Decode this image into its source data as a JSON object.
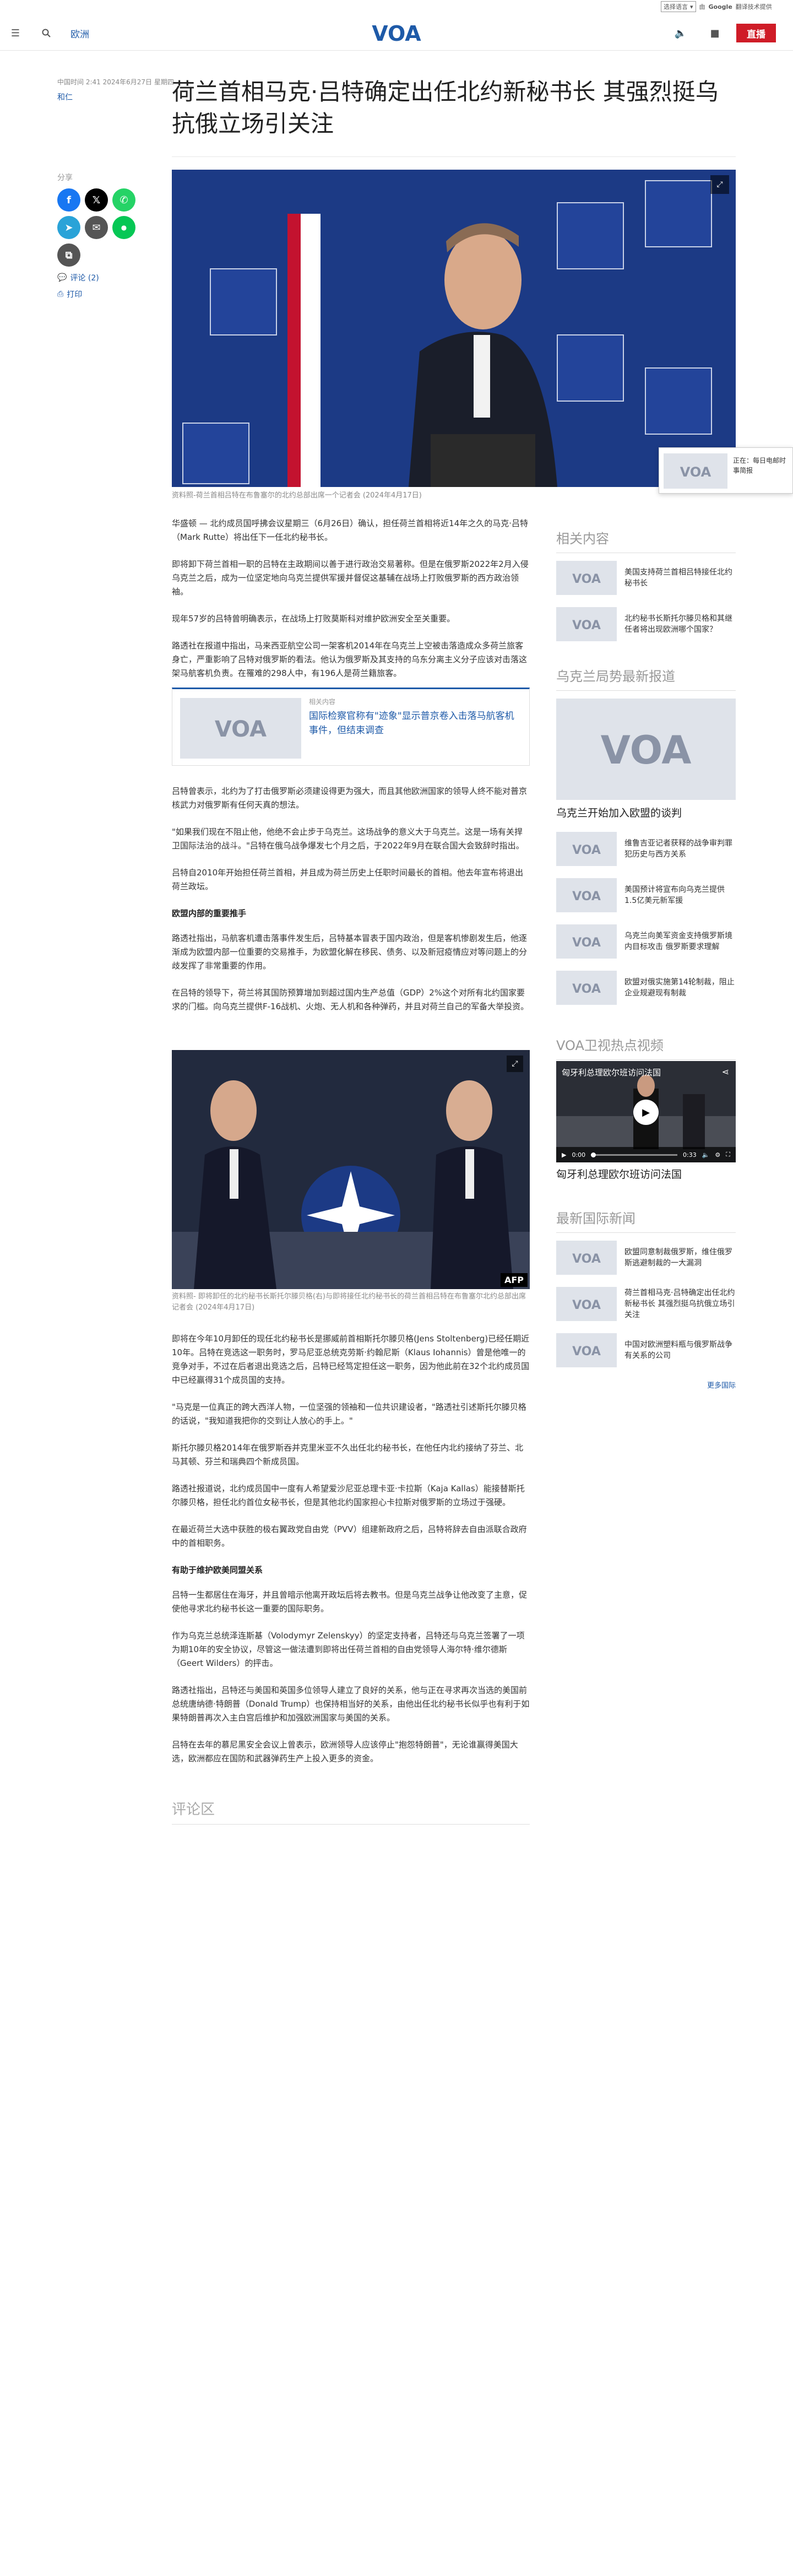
{
  "translate": {
    "select_label": "选择语言",
    "powered_prefix": "由",
    "powered_brand": "Google",
    "powered_suffix": "翻译技术提供"
  },
  "header": {
    "region": "欧洲",
    "logo_text": "VOA",
    "live_label": "直播"
  },
  "article": {
    "date": "中国时间 2:41 2024年6月27日 星期四",
    "author": "和仁",
    "title": "荷兰首相马克·吕特确定出任北约新秘书长 其强烈挺乌抗俄立场引关注",
    "share_label": "分享",
    "comments_link": "评论 (2)",
    "print_link": "打印",
    "hero_caption": "资料照-荷兰首相吕特在布鲁塞尔的北约总部出席一个记者会 (2024年4月17日)",
    "paragraphs_1": [
      "华盛顿 — 北约成员国呼拂会议星期三（6月26日）确认，担任荷兰首相将近14年之久的马克·吕特（Mark Rutte）将出任下一任北约秘书长。",
      "即将卸下荷兰首相一职的吕特在主政期间以善于进行政治交易著称。但是在俄罗斯2022年2月入侵乌克兰之后，成为一位坚定地向乌克兰提供军援并督促这基辅在战场上打败俄罗斯的西方政治领袖。",
      "现年57岁的吕特曾明确表示，在战场上打败莫斯科对维护欧洲安全至关重要。",
      "路透社在报道中指出，马来西亚航空公司一架客机2014年在乌克兰上空被击落造成众多荷兰旅客身亡，严重影响了吕特对俄罗斯的看法。他认为俄罗斯及其支持的乌东分离主义分子应该对击落这架马航客机负责。在罹难的298人中，有196人是荷兰籍旅客。"
    ],
    "related_card": {
      "kicker": "相关内容",
      "headline": "国际检察官称有\"迹象\"显示普京卷入击落马航客机事件，但结束调查"
    },
    "paragraphs_2": [
      "吕特曾表示，北约为了打击俄罗斯必须建设得更为强大，而且其他欧洲国家的领导人终不能对普京核武力对俄罗斯有任何天真的想法。",
      "\"如果我们现在不阻止他，他绝不会止步于乌克兰。这场战争的意义大于乌克兰。这是一场有关捍卫国际法治的战斗。\"吕特在俄乌战争爆发七个月之后，于2022年9月在联合国大会致辞时指出。",
      "吕特自2010年开始担任荷兰首相，并且成为荷兰历史上任职时间最长的首相。他去年宣布将退出荷兰政坛。"
    ],
    "h_1": "欧盟内部的重要推手",
    "paragraphs_3": [
      "路透社指出，马航客机遭击落事件发生后，吕特基本冒表于国内政治，但是客机惨剧发生后，他逐渐成为欧盟内部一位重要的交易推手，为欧盟化解在移民、债务、以及新冠疫情应对等问题上的分歧发挥了非常重要的作用。",
      "在吕特的领导下，荷兰将其国防预算增加到超过国内生产总值（GDP）2%这个对所有北约国家要求的门槛。向乌克兰提供F-16战机、火炮、无人机和各种弹药，并且对荷兰自己的军备大举投资。"
    ],
    "photo2_caption": "资料照- 即将卸任的北约秘书长斯托尔滕贝格(右)与即将接任北约秘书长的荷兰首相吕特在布鲁塞尔北约总部出席记者会 (2024年4月17日)",
    "photo2_badge": "AFP",
    "paragraphs_4": [
      "即将在今年10月卸任的现任北约秘书长是挪威前首相斯托尔滕贝格(Jens Stoltenberg)已经任期近10年。吕特在竞选这一职务时，罗马尼亚总统克劳斯·约翰尼斯（Klaus Iohannis）曾是他唯一的竞争对手，不过在后者退出竞选之后，吕特已经笃定担任这一职务，因为他此前在32个北约成员国中已经赢得31个成员国的支持。",
      "\"马克是一位真正的跨大西洋人物，一位坚强的领袖和一位共识建设者，\"路透社引述斯托尔滕贝格的话说，\"我知道我把你的交到让人放心的手上。\"",
      "斯托尔滕贝格2014年在俄罗斯吞并克里米亚不久出任北约秘书长，在他任内北约接纳了芬兰、北马其顿、芬兰和瑞典四个新成员国。",
      "路透社报道说，北约成员国中一度有人希望爱沙尼亚总理卡亚·卡拉斯（Kaja Kallas）能接替斯托尔滕贝格，担任北约首位女秘书长，但是其他北约国家担心卡拉斯对俄罗斯的立场过于强硬。",
      "在最近荷兰大选中获胜的极右翼政党自由党（PVV）组建新政府之后，吕特将辞去自由派联合政府中的首相职务。"
    ],
    "h_2": "有助于维护欧美同盟关系",
    "paragraphs_5": [
      "吕特一生都居住在海牙，并且曾暗示他离开政坛后将去教书。但是乌克兰战争让他改变了主意，促使他寻求北约秘书长这一重要的国际职务。",
      "作为乌克兰总统泽连斯基（Volodymyr Zelenskyy）的坚定支持者，吕特还与乌克兰签署了一项为期10年的安全协议，尽管这一做法遭到即将出任荷兰首相的自由党领导人海尔特·维尔德斯（Geert Wilders）的抨击。",
      "路透社指出，吕特还与美国和英国多位领导人建立了良好的关系，他与正在寻求再次当选的美国前总统唐纳德·特朗普（Donald Trump）也保持相当好的关系，由他出任北约秘书长似乎也有利于如果特朗普再次入主白宫后维护和加强欧洲国家与美国的关系。",
      "吕特在去年的慕尼黑安全会议上曾表示，欧洲领导人应该停止\"抱怨特朗普\"，无论谁赢得美国大选，欧洲都应在国防和武器弹药生产上投入更多的资金。"
    ],
    "comments_heading": "评论区"
  },
  "sidebar": {
    "related_heading": "相关内容",
    "related": [
      "美国支持荷兰首相吕特接任北约秘书长",
      "北约秘书长斯托尔滕贝格和其继任者将出现欧洲哪个国家？"
    ],
    "ukraine_heading": "乌克兰局势最新报道",
    "ukraine_feature": "乌克兰开始加入欧盟的谈判",
    "ukraine": [
      "维鲁吉亚记者获释的战争审判罪犯历史与西方关系",
      "美国预计将宣布向乌克兰提供1.5亿美元新军援",
      "乌克兰向美军资金支持俄罗斯境内目标攻击 俄罗斯要求理解",
      "欧盟对俄实施第14轮制裁，阻止企业规避现有制裁"
    ],
    "video_heading": "VOA卫视热点视频",
    "video_title": "匈牙利总理欧尔班访问法国",
    "video_time_current": "0:00",
    "video_time_total": "0:33",
    "video_caption": "匈牙利总理欧尔班访问法国",
    "intl_heading": "最新国际新闻",
    "intl": [
      "欧盟同意制裁俄罗斯，维住俄罗斯逃避制裁的一大漏洞",
      "荷兰首相马克·吕特确定出任北约新秘书长 其强烈挺乌抗俄立场引关注",
      "中国对欧洲塑料瓶与俄罗斯战争有关系的公司"
    ],
    "more_link": "更多国际"
  },
  "sticky": {
    "label": "正在：每日电邮时事简报"
  },
  "colors": {
    "brand_blue": "#1e5aa8",
    "live_red": "#cf1c27",
    "facebook": "#1877f2",
    "x": "#000000",
    "whatsapp": "#25d366",
    "telegram": "#2aa3d8",
    "email": "#555555",
    "line": "#06c755"
  },
  "icons": [
    "menu-icon",
    "search-icon",
    "volume-icon",
    "camera-icon",
    "facebook-icon",
    "x-icon",
    "whatsapp-icon",
    "telegram-icon",
    "email-icon",
    "line-icon",
    "link-icon",
    "comment-icon",
    "print-icon",
    "expand-icon",
    "play-icon",
    "share-icon"
  ]
}
